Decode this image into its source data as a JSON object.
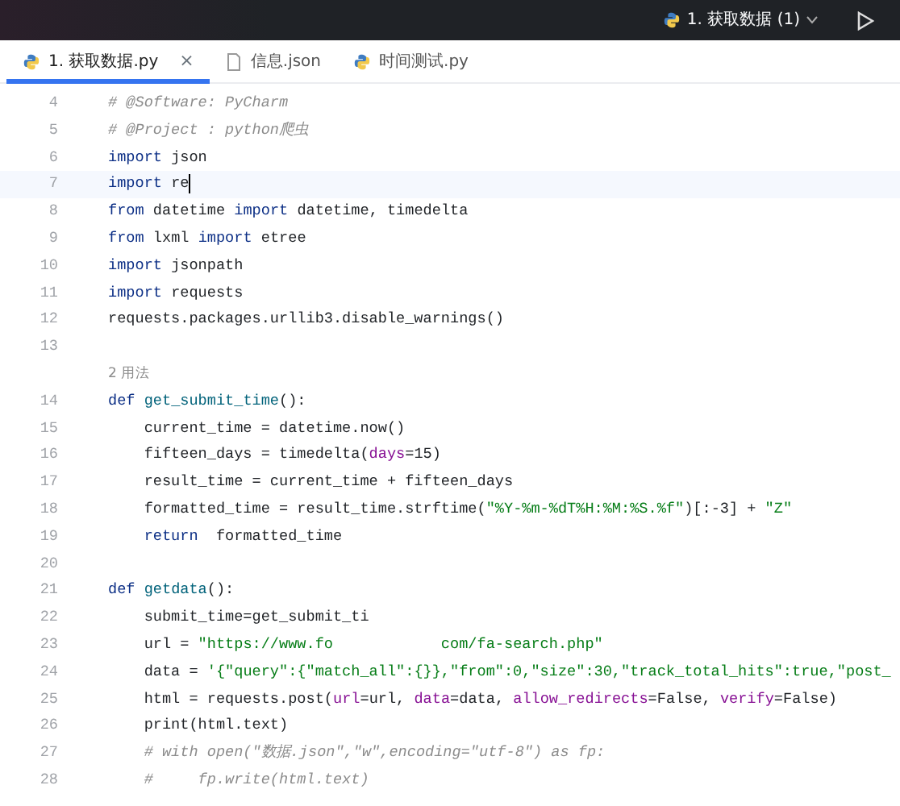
{
  "toolbar": {
    "run_config": "1. 获取数据 (1)"
  },
  "tabs": [
    {
      "label": "1. 获取数据.py",
      "kind": "python",
      "selected": true,
      "close": "×"
    },
    {
      "label": "信息.json",
      "kind": "json",
      "selected": false
    },
    {
      "label": "时间测试.py",
      "kind": "python",
      "selected": false
    }
  ],
  "editor": {
    "lines": [
      {
        "kind": "code",
        "number": "4",
        "current": false,
        "tokens": [
          {
            "t": "# @Software: PyCharm",
            "kind": "comment"
          }
        ]
      },
      {
        "kind": "code",
        "number": "5",
        "current": false,
        "tokens": [
          {
            "t": "# @Project : python爬虫",
            "kind": "comment"
          }
        ]
      },
      {
        "kind": "code",
        "number": "6",
        "current": false,
        "tokens": [
          {
            "t": "import",
            "kind": "kw"
          },
          {
            "t": " json",
            "kind": "plain"
          }
        ]
      },
      {
        "kind": "code",
        "number": "7",
        "current": true,
        "tokens": [
          {
            "t": "import",
            "kind": "kw"
          },
          {
            "t": " re",
            "kind": "plain"
          }
        ]
      },
      {
        "kind": "code",
        "number": "8",
        "current": false,
        "tokens": [
          {
            "t": "from",
            "kind": "kw"
          },
          {
            "t": " datetime ",
            "kind": "plain"
          },
          {
            "t": "import",
            "kind": "kw"
          },
          {
            "t": " datetime, timedelta",
            "kind": "plain"
          }
        ]
      },
      {
        "kind": "code",
        "number": "9",
        "current": false,
        "tokens": [
          {
            "t": "from",
            "kind": "kw"
          },
          {
            "t": " lxml ",
            "kind": "plain"
          },
          {
            "t": "import",
            "kind": "kw"
          },
          {
            "t": " etree",
            "kind": "plain"
          }
        ]
      },
      {
        "kind": "code",
        "number": "10",
        "current": false,
        "tokens": [
          {
            "t": "import",
            "kind": "kw"
          },
          {
            "t": " jsonpath",
            "kind": "plain"
          }
        ]
      },
      {
        "kind": "code",
        "number": "11",
        "current": false,
        "tokens": [
          {
            "t": "import",
            "kind": "kw"
          },
          {
            "t": " requests",
            "kind": "plain"
          }
        ]
      },
      {
        "kind": "code",
        "number": "12",
        "current": false,
        "tokens": [
          {
            "t": "requests.packages.urllib3.disable_warnings()",
            "kind": "plain"
          }
        ]
      },
      {
        "kind": "code",
        "number": "13",
        "current": false
      },
      {
        "kind": "hint",
        "text": "2 用法"
      },
      {
        "kind": "code",
        "number": "14",
        "current": false,
        "tokens": [
          {
            "t": "def ",
            "kind": "kw"
          },
          {
            "t": "get_submit_time",
            "kind": "fn"
          },
          {
            "t": "():",
            "kind": "plain"
          }
        ]
      },
      {
        "kind": "code",
        "number": "15",
        "current": false,
        "tokens": [
          {
            "t": "    current_time = datetime.now()",
            "kind": "plain"
          }
        ]
      },
      {
        "kind": "code",
        "number": "16",
        "current": false,
        "tokens": [
          {
            "t": "    fifteen_days = timedelta(",
            "kind": "plain"
          },
          {
            "t": "days",
            "kind": "param"
          },
          {
            "t": "=15)",
            "kind": "plain"
          }
        ]
      },
      {
        "kind": "code",
        "number": "17",
        "current": false,
        "tokens": [
          {
            "t": "    result_time = current_time + fifteen_days",
            "kind": "plain"
          }
        ]
      },
      {
        "kind": "code",
        "number": "18",
        "current": false,
        "tokens": [
          {
            "t": "    formatted_time = result_time.strftime(",
            "kind": "plain"
          },
          {
            "t": "\"%Y-%m-%dT%H:%M:%S.%f\"",
            "kind": "str"
          },
          {
            "t": ")[:-3] + ",
            "kind": "plain"
          },
          {
            "t": "\"Z\"",
            "kind": "str"
          }
        ]
      },
      {
        "kind": "code",
        "number": "19",
        "current": false,
        "tokens": [
          {
            "t": "    return",
            "kind": "kw"
          },
          {
            "t": "  formatted_time",
            "kind": "plain"
          }
        ]
      },
      {
        "kind": "code",
        "number": "20",
        "current": false
      },
      {
        "kind": "code",
        "number": "21",
        "current": false,
        "tokens": [
          {
            "t": "def ",
            "kind": "kw"
          },
          {
            "t": "getdata",
            "kind": "fn"
          },
          {
            "t": "():",
            "kind": "plain"
          }
        ]
      },
      {
        "kind": "code",
        "number": "22",
        "current": false,
        "tokens": [
          {
            "t": "    submit_time=get_submit_ti",
            "kind": "plain"
          }
        ]
      },
      {
        "kind": "code",
        "number": "23",
        "current": false,
        "tokens": [
          {
            "t": "    url = ",
            "kind": "plain"
          },
          {
            "t": "\"https://www.fo            com/fa-search.php\"",
            "kind": "str"
          }
        ]
      },
      {
        "kind": "code",
        "number": "24",
        "current": false,
        "tokens": [
          {
            "t": "    data = ",
            "kind": "plain"
          },
          {
            "t": "'{\"query\":{\"match_all\":{}},\"from\":0,\"size\":30,\"track_total_hits\":true,\"post_",
            "kind": "str"
          }
        ]
      },
      {
        "kind": "code",
        "number": "25",
        "current": false,
        "tokens": [
          {
            "t": "    html = requests.post(",
            "kind": "plain"
          },
          {
            "t": "url",
            "kind": "param"
          },
          {
            "t": "=url, ",
            "kind": "plain"
          },
          {
            "t": "data",
            "kind": "param"
          },
          {
            "t": "=data, ",
            "kind": "plain"
          },
          {
            "t": "allow_redirects",
            "kind": "param"
          },
          {
            "t": "=False, ",
            "kind": "plain"
          },
          {
            "t": "verify",
            "kind": "param"
          },
          {
            "t": "=False)",
            "kind": "plain"
          }
        ]
      },
      {
        "kind": "code",
        "number": "26",
        "current": false,
        "tokens": [
          {
            "t": "    print(html.text)",
            "kind": "plain"
          }
        ]
      },
      {
        "kind": "code",
        "number": "27",
        "current": false,
        "tokens": [
          {
            "t": "    # with open(\"数据.json\",\"w\",encoding=\"utf-8\") as fp:",
            "kind": "comment"
          }
        ]
      },
      {
        "kind": "code",
        "number": "28",
        "current": false,
        "tokens": [
          {
            "t": "    #     fp.write(html.text)",
            "kind": "comment"
          }
        ]
      }
    ]
  }
}
